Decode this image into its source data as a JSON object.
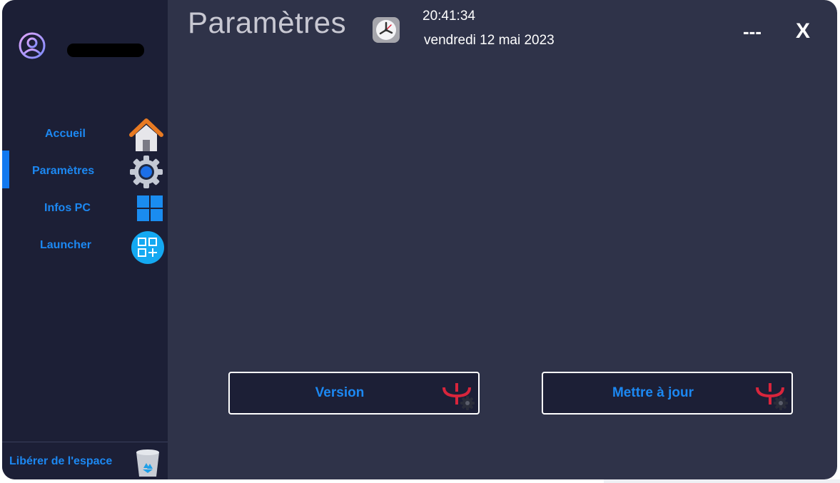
{
  "header": {
    "title": "Paramètres",
    "time": "20:41:34",
    "date": "vendredi 12 mai 2023",
    "minimize_label": "---",
    "close_label": "X"
  },
  "sidebar": {
    "items": [
      {
        "label": "Accueil",
        "icon": "home-icon"
      },
      {
        "label": "Paramètres",
        "icon": "gear-icon",
        "active": true
      },
      {
        "label": "Infos PC",
        "icon": "windows-icon"
      },
      {
        "label": "Launcher",
        "icon": "apps-add-icon"
      }
    ],
    "footer_label": "Libérer de l'espace",
    "footer_icon": "recycle-bin-icon"
  },
  "actions": {
    "version_label": "Version",
    "update_label": "Mettre à jour"
  },
  "colors": {
    "accent": "#1c88f2",
    "sidebar_bg": "#1c1f36",
    "main_bg": "#2f3349",
    "icon_red": "#d8253c"
  }
}
